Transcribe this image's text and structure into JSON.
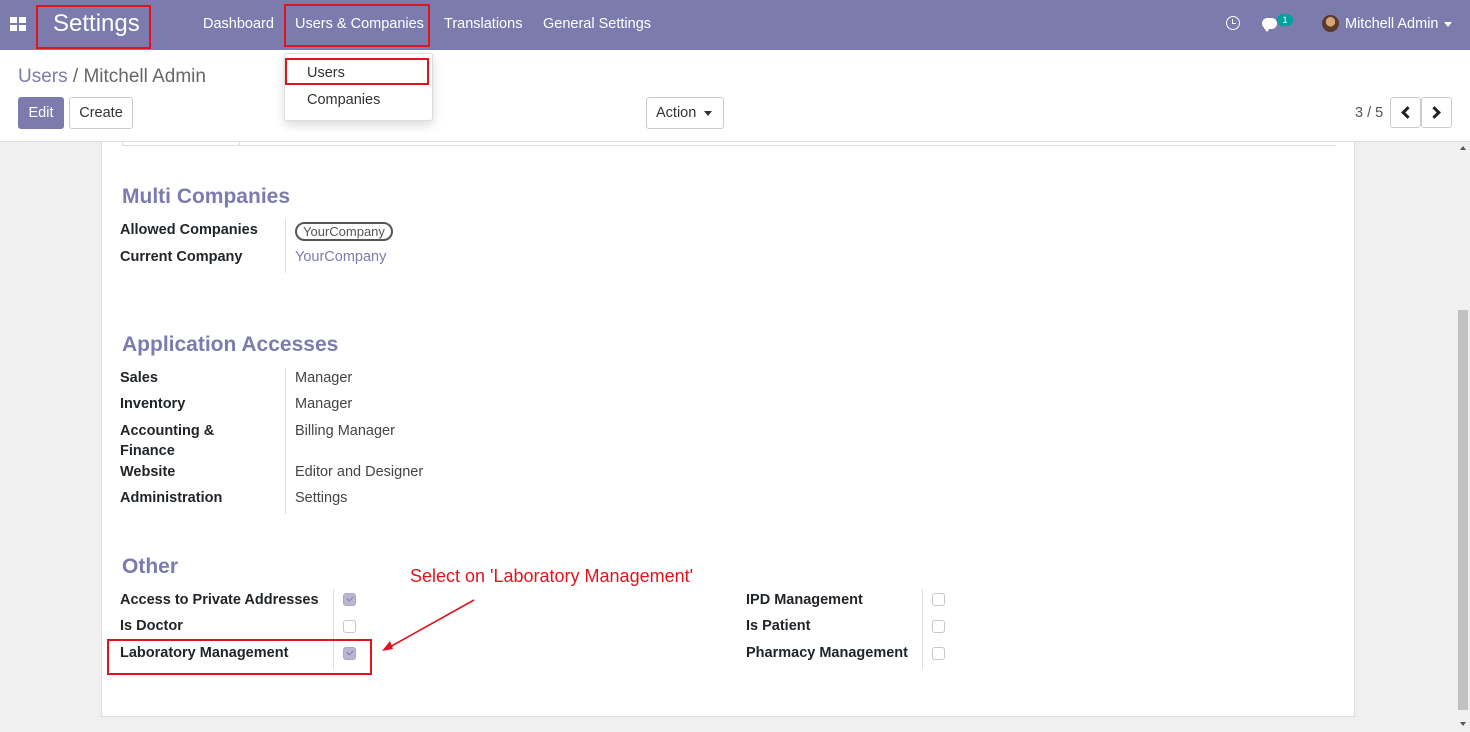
{
  "navbar": {
    "brand": "Settings",
    "menu": [
      "Dashboard",
      "Users & Companies",
      "Translations",
      "General Settings"
    ],
    "chat_badge": "1",
    "user": "Mitchell Admin"
  },
  "dropdown": {
    "items": [
      "Users",
      "Companies"
    ]
  },
  "breadcrumb": {
    "parent": "Users",
    "separator": " / ",
    "current": "Mitchell Admin"
  },
  "toolbar": {
    "edit_label": "Edit",
    "create_label": "Create",
    "action_label": "Action",
    "pager": "3 / 5"
  },
  "multi_companies": {
    "title": "Multi Companies",
    "allowed_label": "Allowed Companies",
    "allowed_value": "YourCompany",
    "current_label": "Current Company",
    "current_value": "YourCompany"
  },
  "app_access": {
    "title": "Application Accesses",
    "rows": [
      {
        "label": "Sales",
        "value": "Manager"
      },
      {
        "label": "Inventory",
        "value": "Manager"
      },
      {
        "label": "Accounting & Finance",
        "value": "Billing Manager"
      },
      {
        "label": "Website",
        "value": "Editor and Designer"
      },
      {
        "label": "Administration",
        "value": "Settings"
      }
    ]
  },
  "other": {
    "title": "Other",
    "left": [
      {
        "label": "Access to Private Addresses",
        "checked": true
      },
      {
        "label": "Is Doctor",
        "checked": false
      },
      {
        "label": "Laboratory Management",
        "checked": true
      }
    ],
    "right": [
      {
        "label": "IPD Management",
        "checked": false
      },
      {
        "label": "Is Patient",
        "checked": false
      },
      {
        "label": "Pharmacy Management",
        "checked": false
      }
    ]
  },
  "annotation": {
    "text": "Select on 'Laboratory Management'",
    "color": "#e0141e"
  },
  "colors": {
    "brand": "#7c7bad",
    "annotation": "#e0141e"
  }
}
